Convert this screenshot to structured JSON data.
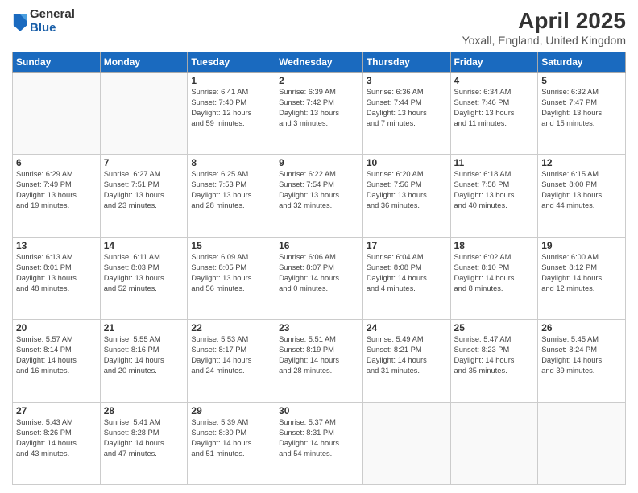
{
  "logo": {
    "general": "General",
    "blue": "Blue"
  },
  "title": {
    "month": "April 2025",
    "location": "Yoxall, England, United Kingdom"
  },
  "weekdays": [
    "Sunday",
    "Monday",
    "Tuesday",
    "Wednesday",
    "Thursday",
    "Friday",
    "Saturday"
  ],
  "days": [
    {
      "day": null,
      "info": null
    },
    {
      "day": null,
      "info": null
    },
    {
      "day": "1",
      "info": "Sunrise: 6:41 AM\nSunset: 7:40 PM\nDaylight: 12 hours\nand 59 minutes."
    },
    {
      "day": "2",
      "info": "Sunrise: 6:39 AM\nSunset: 7:42 PM\nDaylight: 13 hours\nand 3 minutes."
    },
    {
      "day": "3",
      "info": "Sunrise: 6:36 AM\nSunset: 7:44 PM\nDaylight: 13 hours\nand 7 minutes."
    },
    {
      "day": "4",
      "info": "Sunrise: 6:34 AM\nSunset: 7:46 PM\nDaylight: 13 hours\nand 11 minutes."
    },
    {
      "day": "5",
      "info": "Sunrise: 6:32 AM\nSunset: 7:47 PM\nDaylight: 13 hours\nand 15 minutes."
    },
    {
      "day": "6",
      "info": "Sunrise: 6:29 AM\nSunset: 7:49 PM\nDaylight: 13 hours\nand 19 minutes."
    },
    {
      "day": "7",
      "info": "Sunrise: 6:27 AM\nSunset: 7:51 PM\nDaylight: 13 hours\nand 23 minutes."
    },
    {
      "day": "8",
      "info": "Sunrise: 6:25 AM\nSunset: 7:53 PM\nDaylight: 13 hours\nand 28 minutes."
    },
    {
      "day": "9",
      "info": "Sunrise: 6:22 AM\nSunset: 7:54 PM\nDaylight: 13 hours\nand 32 minutes."
    },
    {
      "day": "10",
      "info": "Sunrise: 6:20 AM\nSunset: 7:56 PM\nDaylight: 13 hours\nand 36 minutes."
    },
    {
      "day": "11",
      "info": "Sunrise: 6:18 AM\nSunset: 7:58 PM\nDaylight: 13 hours\nand 40 minutes."
    },
    {
      "day": "12",
      "info": "Sunrise: 6:15 AM\nSunset: 8:00 PM\nDaylight: 13 hours\nand 44 minutes."
    },
    {
      "day": "13",
      "info": "Sunrise: 6:13 AM\nSunset: 8:01 PM\nDaylight: 13 hours\nand 48 minutes."
    },
    {
      "day": "14",
      "info": "Sunrise: 6:11 AM\nSunset: 8:03 PM\nDaylight: 13 hours\nand 52 minutes."
    },
    {
      "day": "15",
      "info": "Sunrise: 6:09 AM\nSunset: 8:05 PM\nDaylight: 13 hours\nand 56 minutes."
    },
    {
      "day": "16",
      "info": "Sunrise: 6:06 AM\nSunset: 8:07 PM\nDaylight: 14 hours\nand 0 minutes."
    },
    {
      "day": "17",
      "info": "Sunrise: 6:04 AM\nSunset: 8:08 PM\nDaylight: 14 hours\nand 4 minutes."
    },
    {
      "day": "18",
      "info": "Sunrise: 6:02 AM\nSunset: 8:10 PM\nDaylight: 14 hours\nand 8 minutes."
    },
    {
      "day": "19",
      "info": "Sunrise: 6:00 AM\nSunset: 8:12 PM\nDaylight: 14 hours\nand 12 minutes."
    },
    {
      "day": "20",
      "info": "Sunrise: 5:57 AM\nSunset: 8:14 PM\nDaylight: 14 hours\nand 16 minutes."
    },
    {
      "day": "21",
      "info": "Sunrise: 5:55 AM\nSunset: 8:16 PM\nDaylight: 14 hours\nand 20 minutes."
    },
    {
      "day": "22",
      "info": "Sunrise: 5:53 AM\nSunset: 8:17 PM\nDaylight: 14 hours\nand 24 minutes."
    },
    {
      "day": "23",
      "info": "Sunrise: 5:51 AM\nSunset: 8:19 PM\nDaylight: 14 hours\nand 28 minutes."
    },
    {
      "day": "24",
      "info": "Sunrise: 5:49 AM\nSunset: 8:21 PM\nDaylight: 14 hours\nand 31 minutes."
    },
    {
      "day": "25",
      "info": "Sunrise: 5:47 AM\nSunset: 8:23 PM\nDaylight: 14 hours\nand 35 minutes."
    },
    {
      "day": "26",
      "info": "Sunrise: 5:45 AM\nSunset: 8:24 PM\nDaylight: 14 hours\nand 39 minutes."
    },
    {
      "day": "27",
      "info": "Sunrise: 5:43 AM\nSunset: 8:26 PM\nDaylight: 14 hours\nand 43 minutes."
    },
    {
      "day": "28",
      "info": "Sunrise: 5:41 AM\nSunset: 8:28 PM\nDaylight: 14 hours\nand 47 minutes."
    },
    {
      "day": "29",
      "info": "Sunrise: 5:39 AM\nSunset: 8:30 PM\nDaylight: 14 hours\nand 51 minutes."
    },
    {
      "day": "30",
      "info": "Sunrise: 5:37 AM\nSunset: 8:31 PM\nDaylight: 14 hours\nand 54 minutes."
    },
    {
      "day": null,
      "info": null
    },
    {
      "day": null,
      "info": null
    },
    {
      "day": null,
      "info": null
    }
  ]
}
